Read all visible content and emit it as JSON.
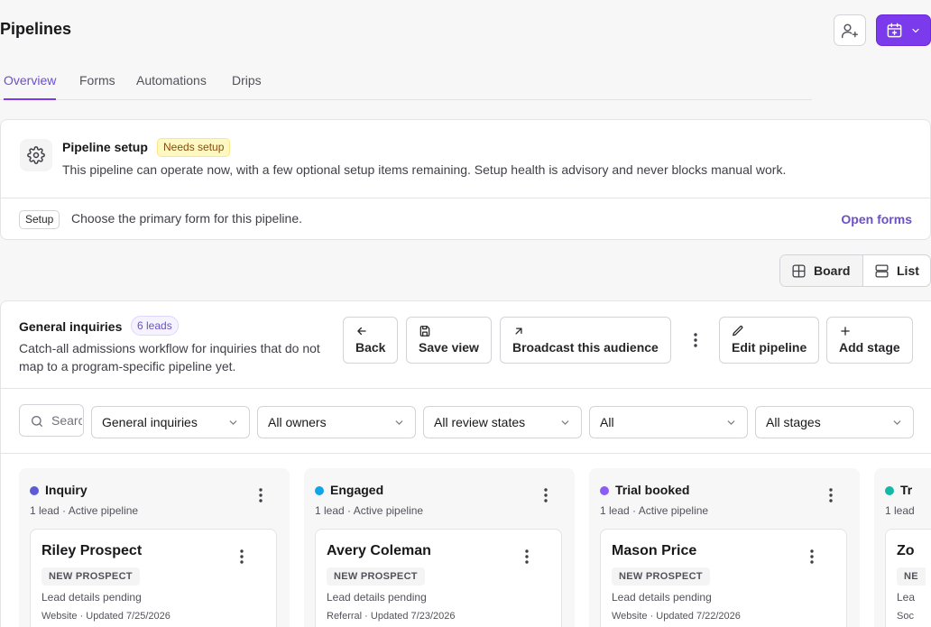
{
  "header": {
    "title": "Pipelines"
  },
  "tabs": [
    {
      "label": "Overview",
      "active": true
    },
    {
      "label": "Forms",
      "active": false
    },
    {
      "label": "Automations",
      "active": false
    },
    {
      "label": "Drips",
      "active": false
    }
  ],
  "setup": {
    "title": "Pipeline setup",
    "badge": "Needs setup",
    "description": "This pipeline can operate now, with a few optional setup items remaining. Setup health is advisory and never blocks manual work.",
    "row_tag": "Setup",
    "row_text": "Choose the primary form for this pipeline.",
    "row_link": "Open forms"
  },
  "view_toggle": {
    "board": "Board",
    "list": "List",
    "selected": "Board"
  },
  "pipeline": {
    "name": "General inquiries",
    "lead_count": "6 leads",
    "description": "Catch-all admissions workflow for inquiries that do not map to a program-specific pipeline yet.",
    "actions": {
      "back": "Back",
      "save_view": "Save view",
      "broadcast": "Broadcast this audience",
      "edit_pipeline": "Edit pipeline",
      "add_stage": "Add stage"
    }
  },
  "filters": {
    "search_placeholder": "Search",
    "pipeline": "General inquiries",
    "owners": "All owners",
    "review_states": "All review states",
    "all": "All",
    "stages": "All stages"
  },
  "columns": [
    {
      "name": "Inquiry",
      "color": "#5b5bd6",
      "meta": "1 lead · Active pipeline",
      "lead": {
        "name": "Riley Prospect",
        "status": "NEW PROSPECT",
        "details": "Lead details pending",
        "source": "Website · Updated 7/25/2026"
      }
    },
    {
      "name": "Engaged",
      "color": "#0ea5e9",
      "meta": "1 lead · Active pipeline",
      "lead": {
        "name": "Avery Coleman",
        "status": "NEW PROSPECT",
        "details": "Lead details pending",
        "source": "Referral · Updated 7/23/2026"
      }
    },
    {
      "name": "Trial booked",
      "color": "#8b5cf6",
      "meta": "1 lead · Active pipeline",
      "lead": {
        "name": "Mason Price",
        "status": "NEW PROSPECT",
        "details": "Lead details pending",
        "source": "Website · Updated 7/22/2026"
      }
    },
    {
      "name": "Tr",
      "color": "#14b8a6",
      "meta": "1 lead",
      "lead": {
        "name": "Zo",
        "status": "NE",
        "details": "Lea",
        "source": "Soc"
      }
    }
  ]
}
